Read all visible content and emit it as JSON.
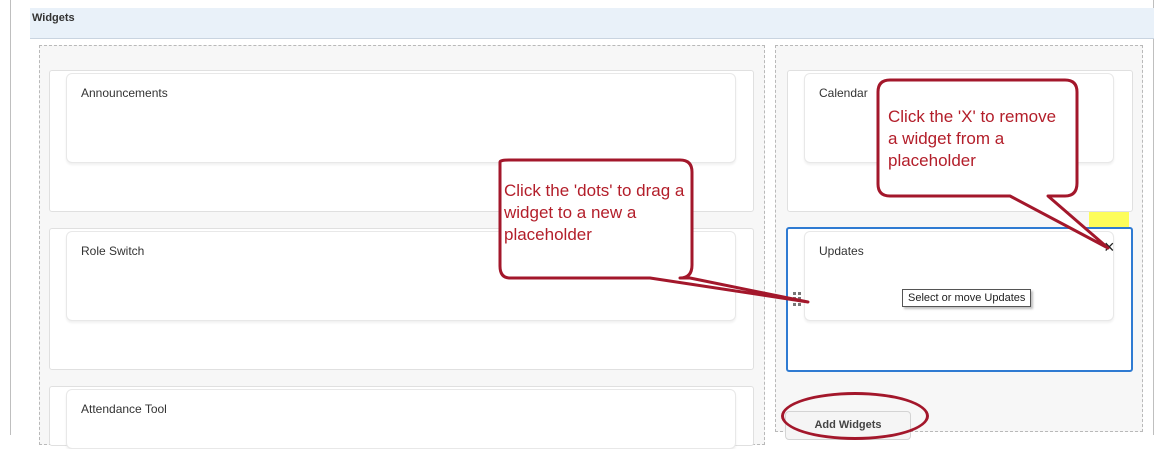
{
  "header": {
    "title": "Widgets"
  },
  "left_column": {
    "widgets": [
      {
        "title": "Announcements"
      },
      {
        "title": "Role Switch"
      },
      {
        "title": "Attendance Tool"
      }
    ]
  },
  "right_column": {
    "widgets": [
      {
        "title": "Calendar"
      },
      {
        "title": "Updates"
      }
    ],
    "tooltip": "Select or move Updates",
    "close_icon": "×",
    "add_button": "Add Widgets"
  },
  "callouts": {
    "drag": "Click the 'dots' to drag a widget to a new a placeholder",
    "remove": "Click the 'X' to remove a widget from a placeholder"
  },
  "colors": {
    "callout": "#b31e2a",
    "highlight": "#fdfd5a",
    "selected_border": "#2f7bd2"
  }
}
